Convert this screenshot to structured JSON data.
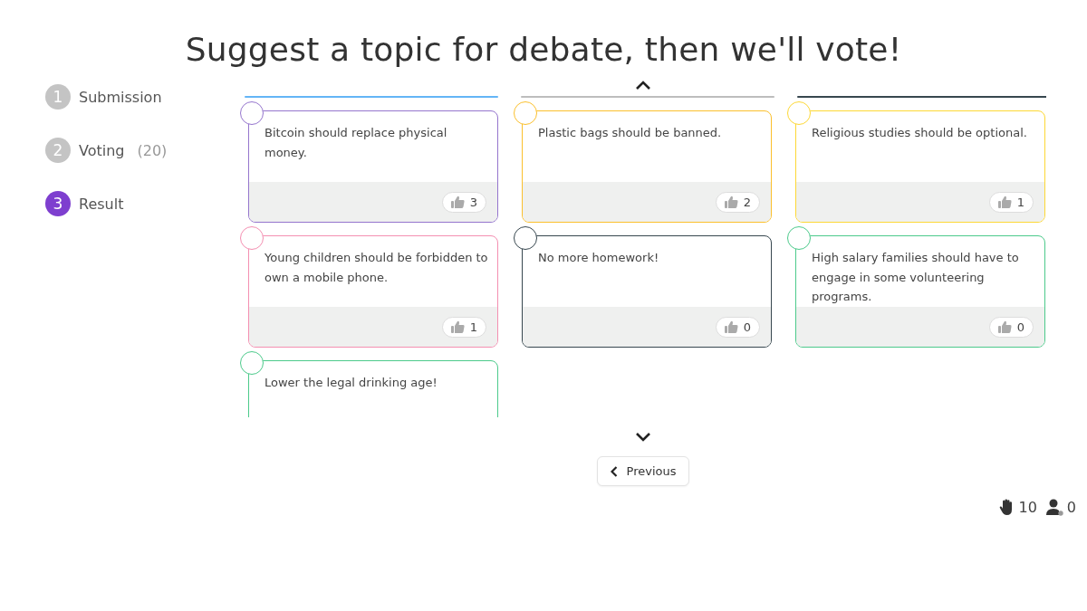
{
  "title": "Suggest a topic for debate, then we'll vote!",
  "steps": [
    {
      "number": "1",
      "label": "Submission",
      "selected": false
    },
    {
      "number": "2",
      "label": "Voting",
      "count": "(20)",
      "selected": false
    },
    {
      "number": "3",
      "label": "Result",
      "selected": true
    }
  ],
  "cut_off_cards": [
    {
      "color": "#64b5f6"
    },
    {
      "color": "#bdbdbd"
    },
    {
      "color": "#37474f"
    }
  ],
  "cards": [
    {
      "text": "Bitcoin should replace physical money.",
      "color": "#9575cd",
      "votes": "3"
    },
    {
      "text": "Plastic bags should be banned.",
      "color": "#fbc02d",
      "votes": "2"
    },
    {
      "text": "Religious studies should be optional.",
      "color": "#fdd835",
      "votes": "1"
    },
    {
      "text": "Young children should be forbidden to own a mobile phone.",
      "color": "#f48fb1",
      "votes": "1"
    },
    {
      "text": "No more homework!",
      "color": "#37474f",
      "votes": "0"
    },
    {
      "text": "High salary families should have to engage in some volunteering programs.",
      "color": "#4cca8b",
      "votes": "0"
    },
    {
      "text": "Lower the legal drinking age!",
      "color": "#4cca8b"
    }
  ],
  "previous_button": "Previous",
  "footer": {
    "hands": "10",
    "participants": "0"
  }
}
